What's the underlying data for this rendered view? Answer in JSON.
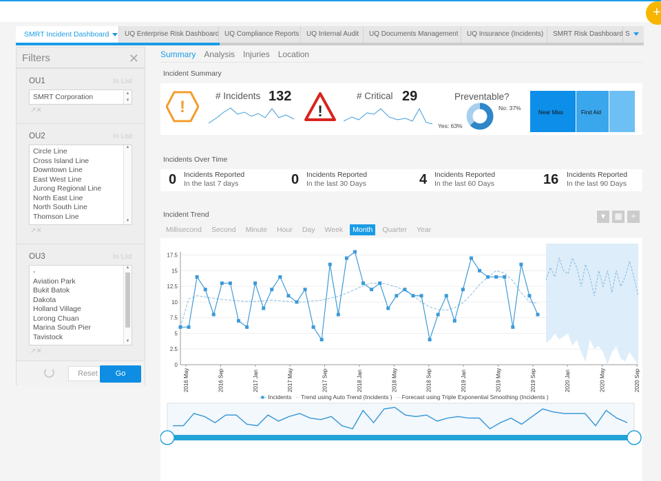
{
  "top": {
    "fab": "+"
  },
  "tabs": [
    {
      "label": "SMRT Incident Dashboard",
      "active": true
    },
    {
      "label": "UQ Enterprise Risk Dashboard"
    },
    {
      "label": "UQ Compliance Reports"
    },
    {
      "label": "UQ Internal Audit"
    },
    {
      "label": "UQ Documents Management"
    },
    {
      "label": "UQ Insurance (Incidents)"
    },
    {
      "label": "SMRT Risk Dashboard"
    },
    {
      "label": "S"
    }
  ],
  "filters": {
    "title": "Filters",
    "ou1": {
      "label": "OU1",
      "inlist": "In List",
      "value": "SMRT Corporation"
    },
    "ou2": {
      "label": "OU2",
      "inlist": "In List",
      "items": [
        "Circle Line",
        "Cross Island Line",
        "Downtown Line",
        "East West Line",
        "Jurong Regional Line",
        "North East Line",
        "North South Line",
        "Thomson Line"
      ]
    },
    "ou3": {
      "label": "OU3",
      "inlist": "In List",
      "items": [
        "-",
        "Aviation Park",
        "Bukit Batok",
        "Dakota",
        "Holland Village",
        "Lorong Chuan",
        "Marina South Pier",
        "Tavistock"
      ]
    },
    "reset": "Reset",
    "go": "Go"
  },
  "subnav": [
    "Summary",
    "Analysis",
    "Injuries",
    "Location"
  ],
  "summary": {
    "title": "Incident Summary",
    "incidents_label": "# Incidents",
    "incidents_value": "132",
    "critical_label": "# Critical",
    "critical_value": "29",
    "preventable_title": "Preventable?",
    "no_label": "No: 37%",
    "yes_label": "Yes: 63%",
    "preventable_yes": 0.63,
    "treemap": [
      "Near Miss",
      "First Aid",
      ""
    ]
  },
  "over_time": {
    "title": "Incidents Over Time",
    "items": [
      {
        "num": "0",
        "l1": "Incidents Reported",
        "l2": "In the last 7 days"
      },
      {
        "num": "0",
        "l1": "Incidents Reported",
        "l2": "In the last 30 Days"
      },
      {
        "num": "4",
        "l1": "Incidents Reported",
        "l2": "In the last 60 Days"
      },
      {
        "num": "16",
        "l1": "Incidents Reported",
        "l2": "In the last 90 Days"
      }
    ]
  },
  "trend": {
    "title": "Incident Trend",
    "granularity": [
      "Millisecond",
      "Second",
      "Minute",
      "Hour",
      "Day",
      "Week",
      "Month",
      "Quarter",
      "Year"
    ],
    "active_granularity": "Month",
    "legend": [
      "Incidents",
      "Trend using Auto Trend (Incidents )",
      "Forecast using Triple Exponential Smoothing (Incidents )"
    ]
  },
  "chart_data": {
    "type": "line",
    "x_ticks": [
      "2016 May",
      "2016 Sep",
      "2017 Jan",
      "2017 May",
      "2017 Sep",
      "2018 Jan",
      "2018 May",
      "2018 Sep",
      "2019 Jan",
      "2019 May",
      "2019 Sep",
      "2020 Jan",
      "2020 May",
      "2020 Sep"
    ],
    "y_ticks": [
      "0",
      "2.5",
      "5",
      "7.5",
      "10",
      "12.5",
      "15",
      "17.5"
    ],
    "ylim": [
      0,
      18
    ],
    "series": [
      {
        "name": "Incidents",
        "values": [
          6,
          6,
          14,
          12,
          8,
          13,
          13,
          7,
          6,
          13,
          9,
          12,
          14,
          11,
          10,
          12,
          6,
          4,
          16,
          8,
          17,
          18,
          13,
          12,
          13,
          9,
          11,
          12,
          11,
          11,
          4,
          8,
          11,
          7,
          12,
          17,
          15,
          14,
          14,
          14,
          6,
          16,
          11,
          8
        ]
      }
    ],
    "trend": [
      6,
      10.5,
      11,
      10.8,
      10.6,
      10.4,
      10.3,
      10.2,
      10.1,
      10.1,
      10.2,
      10.3,
      10.2,
      10.1,
      10,
      10,
      10.2,
      10.3,
      10.6,
      10.9,
      11.4,
      12,
      12.6,
      13,
      13,
      12.8,
      12.4,
      11.8,
      11,
      10,
      9.2,
      8.8,
      8.7,
      9.1,
      9.9,
      11.2,
      12.8,
      14,
      15,
      14.6,
      13.4,
      11.5,
      10,
      9.8
    ],
    "forecast_mid": [
      13.5,
      15.5,
      14,
      17,
      15,
      14.5,
      17,
      15.5,
      12.5,
      16,
      14,
      11,
      15,
      12.5,
      15,
      11.5,
      15,
      12.5,
      14,
      16.5,
      14,
      11
    ],
    "forecast_low": [
      3.5,
      4,
      5,
      4,
      4.5,
      5,
      3,
      4,
      2,
      0.5,
      4,
      2.5,
      3,
      2,
      0,
      2,
      3,
      1,
      0.5,
      2,
      1,
      0
    ]
  }
}
